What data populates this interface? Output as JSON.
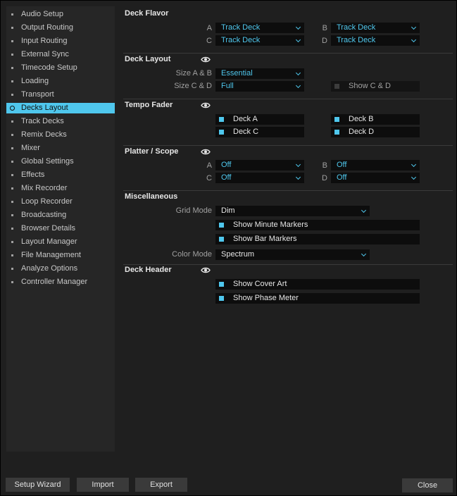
{
  "sidebar": {
    "items": [
      {
        "label": "Audio Setup"
      },
      {
        "label": "Output Routing"
      },
      {
        "label": "Input Routing"
      },
      {
        "label": "External Sync"
      },
      {
        "label": "Timecode Setup"
      },
      {
        "label": "Loading"
      },
      {
        "label": "Transport"
      },
      {
        "label": "Decks Layout",
        "selected": true
      },
      {
        "label": "Track Decks"
      },
      {
        "label": "Remix Decks"
      },
      {
        "label": "Mixer"
      },
      {
        "label": "Global Settings"
      },
      {
        "label": "Effects"
      },
      {
        "label": "Mix Recorder"
      },
      {
        "label": "Loop Recorder"
      },
      {
        "label": "Broadcasting"
      },
      {
        "label": "Browser Details"
      },
      {
        "label": "Layout Manager"
      },
      {
        "label": "File Management"
      },
      {
        "label": "Analyze Options"
      },
      {
        "label": "Controller Manager"
      }
    ]
  },
  "deck_flavor": {
    "title": "Deck Flavor",
    "a_label": "A",
    "a_value": "Track Deck",
    "b_label": "B",
    "b_value": "Track Deck",
    "c_label": "C",
    "c_value": "Track Deck",
    "d_label": "D",
    "d_value": "Track Deck"
  },
  "deck_layout": {
    "title": "Deck Layout",
    "size_ab_label": "Size A & B",
    "size_ab_value": "Essential",
    "size_cd_label": "Size C & D",
    "size_cd_value": "Full",
    "show_cd_label": "Show C & D",
    "show_cd_checked": false
  },
  "tempo_fader": {
    "title": "Tempo Fader",
    "deck_a": "Deck A",
    "deck_b": "Deck B",
    "deck_c": "Deck C",
    "deck_d": "Deck D"
  },
  "platter_scope": {
    "title": "Platter / Scope",
    "a_label": "A",
    "a_value": "Off",
    "b_label": "B",
    "b_value": "Off",
    "c_label": "C",
    "c_value": "Off",
    "d_label": "D",
    "d_value": "Off"
  },
  "misc": {
    "title": "Miscellaneous",
    "grid_mode_label": "Grid Mode",
    "grid_mode_value": "Dim",
    "show_minute_markers": "Show Minute Markers",
    "show_bar_markers": "Show Bar Markers",
    "color_mode_label": "Color Mode",
    "color_mode_value": "Spectrum"
  },
  "deck_header": {
    "title": "Deck Header",
    "show_cover_art": "Show Cover Art",
    "show_phase_meter": "Show Phase Meter"
  },
  "footer": {
    "setup_wizard": "Setup Wizard",
    "import": "Import",
    "export": "Export",
    "close": "Close"
  },
  "colors": {
    "accent": "#4fc7ed",
    "background": "#1f1f1f",
    "sidebar": "#262626"
  },
  "icons": [
    "eye-icon",
    "chevron-down-icon",
    "bullet-icon"
  ]
}
